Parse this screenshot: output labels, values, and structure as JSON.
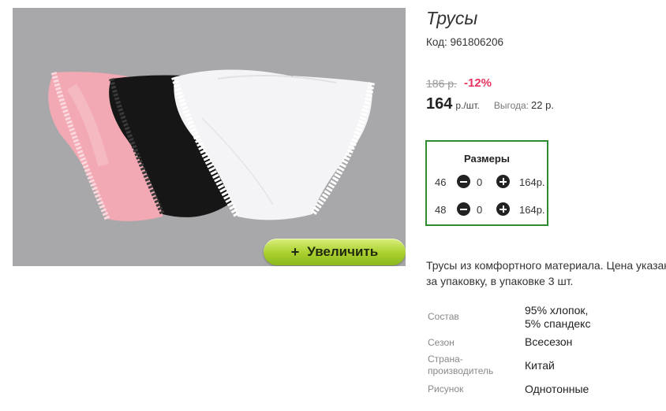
{
  "product": {
    "title": "Трусы",
    "code_label": "Код: 961806206"
  },
  "image": {
    "zoom_button": {
      "plus": "+",
      "label": "Увеличить"
    }
  },
  "price": {
    "old": "186 р.",
    "discount": "-12%",
    "current": "164",
    "unit": "р./шт.",
    "benefit_label": "Выгода:",
    "benefit_value": "22 р."
  },
  "sizes": {
    "title": "Размеры",
    "rows": [
      {
        "size": "46",
        "qty": "0",
        "price": "164р."
      },
      {
        "size": "48",
        "qty": "0",
        "price": "164р."
      }
    ]
  },
  "description": {
    "line1": "Трусы из комфортного материала. Цена указана",
    "line2": "за упаковку, в упаковке 3 шт."
  },
  "specs": [
    {
      "label": "Состав",
      "value_line1": "95% хлопок,",
      "value_line2": "5% спандекс"
    },
    {
      "label": "Сезон",
      "value_line1": "Всесезон",
      "value_line2": ""
    },
    {
      "label_line1": "Страна-",
      "label_line2": "производитель",
      "value_line1": "Китай",
      "value_line2": ""
    },
    {
      "label": "Рисунок",
      "value_line1": "Однотонные",
      "value_line2": ""
    }
  ],
  "colors": {
    "discount": "#e8345f",
    "sizes_border": "#2f8b2f",
    "zoom_button": "#a9cf2e",
    "photo_background": "#a8a8ab"
  }
}
